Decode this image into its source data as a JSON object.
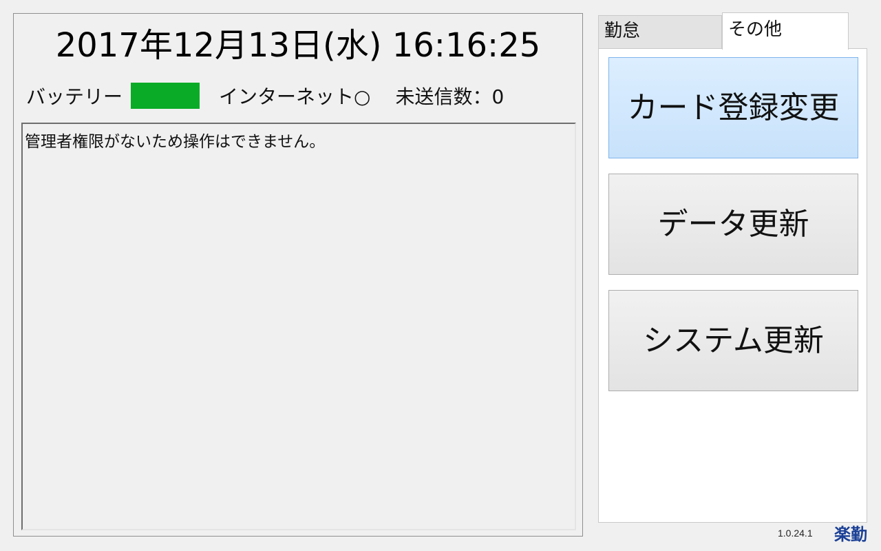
{
  "clock": {
    "datetime": "2017年12月13日(水) 16:16:25"
  },
  "status": {
    "battery_label": "バッテリー",
    "battery_color": "#0aab27",
    "internet_label": "インターネット○",
    "unsent_label": "未送信数：0"
  },
  "message": {
    "text": "管理者権限がないため操作はできません。"
  },
  "tabs": [
    {
      "label": "勤怠",
      "selected": false
    },
    {
      "label": "その他",
      "selected": true
    }
  ],
  "buttons": [
    {
      "label": "カード登録変更",
      "active": true
    },
    {
      "label": "データ更新",
      "active": false
    },
    {
      "label": "システム更新",
      "active": false
    }
  ],
  "footer": {
    "version": "1.0.24.1",
    "logo_text": "楽勤",
    "logo_icon": "rakukin-logo-icon"
  }
}
